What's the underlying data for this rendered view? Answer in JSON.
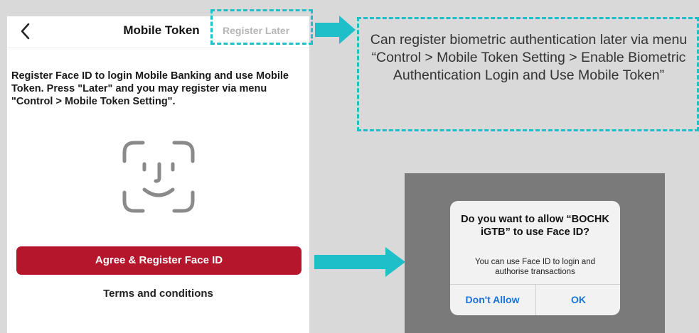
{
  "screen": {
    "title": "Mobile Token",
    "register_later": "Register Later",
    "intro_text": "Register Face ID to login Mobile Banking and use Mobile Token. Press \"Later\" and you may register via menu \"Control > Mobile Token Setting\".",
    "primary_button": "Agree & Register Face ID",
    "terms_link": "Terms and conditions",
    "icons": [
      "back-arrow",
      "face-id"
    ]
  },
  "annotation": {
    "callout_text": "Can register biometric authentication later via menu “Control > Mobile Token Setting > Enable Biometric Authentication Login and Use Mobile Token”",
    "highlight_color": "#1ebfc8"
  },
  "dialog": {
    "title": "Do you want to allow “BOCHK iGTB” to use Face ID?",
    "message": "You can use Face ID to login and authorise transactions",
    "deny_label": "Don't Allow",
    "ok_label": "OK"
  },
  "colors": {
    "primary_button": "#b5162b",
    "link_blue": "#1a73d9",
    "background": "#d9d9d9"
  }
}
